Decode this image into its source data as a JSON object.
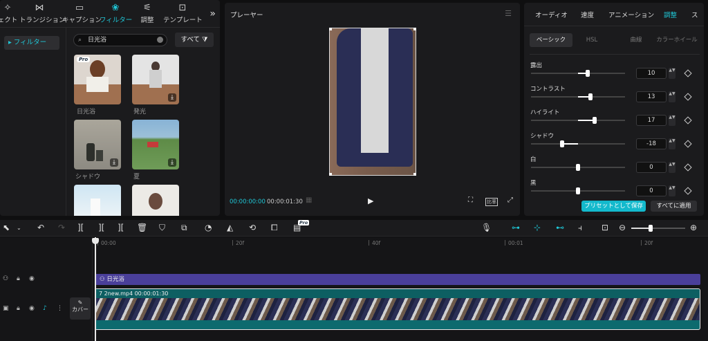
{
  "left_tabs": [
    {
      "label": "ェクト",
      "icon": "effects-icon"
    },
    {
      "label": "トランジション",
      "icon": "transition-icon"
    },
    {
      "label": "キャプション",
      "icon": "caption-icon"
    },
    {
      "label": "フィルター",
      "icon": "filter-icon"
    },
    {
      "label": "調整",
      "icon": "adjust-icon"
    },
    {
      "label": "テンプレート",
      "icon": "template-icon"
    }
  ],
  "filter_sidebar": {
    "item": "▸ フィルター"
  },
  "search": {
    "value": "日光浴"
  },
  "all_button": "すべて",
  "filters": [
    {
      "label": "日光浴",
      "pro": "Pro"
    },
    {
      "label": "発光"
    },
    {
      "label": "シャドウ"
    },
    {
      "label": "夏"
    }
  ],
  "player": {
    "title": "プレーヤー",
    "current_time": "00:00:00:00",
    "total_time": "00:00:01:30",
    "ratio": "比率"
  },
  "adjust_tabs": [
    "オーディオ",
    "速度",
    "アニメーション",
    "調整",
    "ス"
  ],
  "adjust_subtabs": [
    "ベーシック",
    "HSL",
    "曲線",
    "カラーホイール"
  ],
  "params": [
    {
      "label": "露出",
      "value": "10",
      "level": 0.6
    },
    {
      "label": "コントラスト",
      "value": "13",
      "level": 0.63
    },
    {
      "label": "ハイライト",
      "value": "17",
      "level": 0.68
    },
    {
      "label": "シャドウ",
      "value": "-18",
      "level": 0.33
    },
    {
      "label": "白",
      "value": "0",
      "level": 0.5
    },
    {
      "label": "黒",
      "value": "0",
      "level": 0.5
    }
  ],
  "buttons": {
    "save_preset": "プリセットとして保存",
    "apply_all": "すべてに適用"
  },
  "toolbar": {
    "pro": "Pro"
  },
  "ruler": [
    "00:00",
    "20f",
    "40f",
    "00:01",
    "20f"
  ],
  "timeline": {
    "filter_clip": "日光浴",
    "video_clip": "7  2new.mp4   00:00:01:30",
    "cover": "カバー"
  },
  "colors": {
    "accent": "#1fc8d8",
    "filter_clip": "#4a3f9a",
    "video_clip": "#0d6a6e"
  }
}
